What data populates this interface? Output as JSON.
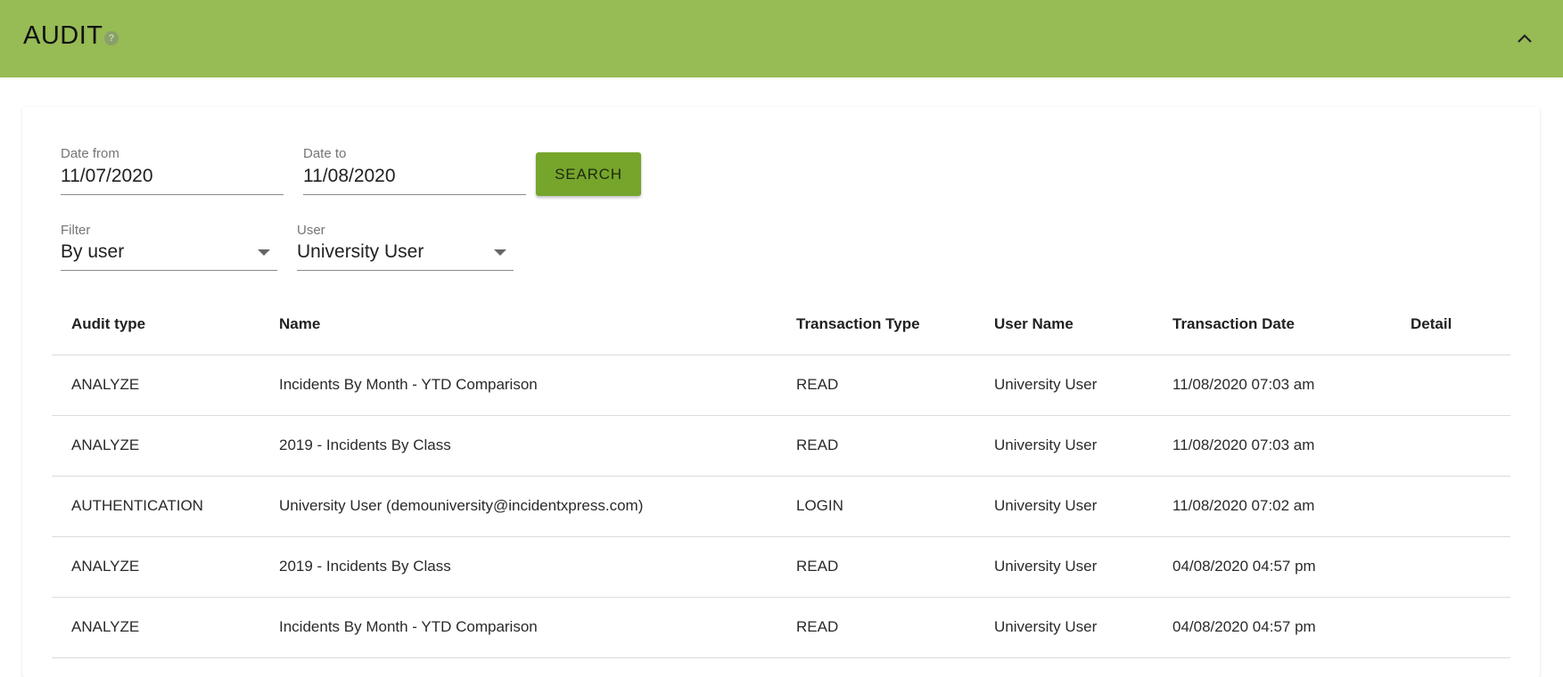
{
  "header": {
    "title": "AUDIT",
    "help_icon": "help-circle-icon",
    "collapse_icon": "chevron-up-icon",
    "background": "#97bb55"
  },
  "filters": {
    "date_from": {
      "label": "Date from",
      "value": "11/07/2020"
    },
    "date_to": {
      "label": "Date to",
      "value": "11/08/2020"
    },
    "search_label": "SEARCH",
    "filter": {
      "label": "Filter",
      "value": "By user"
    },
    "user": {
      "label": "User",
      "value": "University User"
    },
    "button_color": "#76a52c"
  },
  "table": {
    "columns": [
      "Audit type",
      "Name",
      "Transaction Type",
      "User Name",
      "Transaction Date",
      "Detail"
    ],
    "rows": [
      {
        "audit_type": "ANALYZE",
        "name": "Incidents By Month - YTD Comparison",
        "transaction_type": "READ",
        "user_name": "University User",
        "transaction_date": "11/08/2020 07:03 am",
        "detail": ""
      },
      {
        "audit_type": "ANALYZE",
        "name": "2019 - Incidents By Class",
        "transaction_type": "READ",
        "user_name": "University User",
        "transaction_date": "11/08/2020 07:03 am",
        "detail": ""
      },
      {
        "audit_type": "AUTHENTICATION",
        "name": "University User (demouniversity@incidentxpress.com)",
        "transaction_type": "LOGIN",
        "user_name": "University User",
        "transaction_date": "11/08/2020 07:02 am",
        "detail": ""
      },
      {
        "audit_type": "ANALYZE",
        "name": "2019 - Incidents By Class",
        "transaction_type": "READ",
        "user_name": "University User",
        "transaction_date": "04/08/2020 04:57 pm",
        "detail": ""
      },
      {
        "audit_type": "ANALYZE",
        "name": "Incidents By Month - YTD Comparison",
        "transaction_type": "READ",
        "user_name": "University User",
        "transaction_date": "04/08/2020 04:57 pm",
        "detail": ""
      }
    ]
  }
}
